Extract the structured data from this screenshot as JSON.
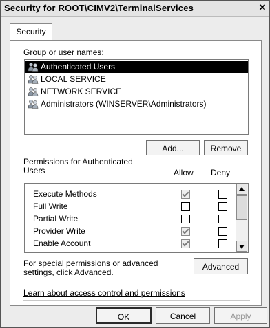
{
  "window": {
    "title": "Security for ROOT\\CIMV2\\TerminalServices",
    "close_glyph": "✕"
  },
  "tabs": [
    {
      "label": "Security"
    }
  ],
  "groups": {
    "label": "Group or user names:",
    "items": [
      {
        "label": "Authenticated Users",
        "selected": true
      },
      {
        "label": "LOCAL SERVICE",
        "selected": false
      },
      {
        "label": "NETWORK SERVICE",
        "selected": false
      },
      {
        "label": "Administrators (WINSERVER\\Administrators)",
        "selected": false
      }
    ],
    "add_label": "Add...",
    "remove_label": "Remove"
  },
  "permissions": {
    "label": "Permissions for Authenticated Users",
    "allow_label": "Allow",
    "deny_label": "Deny",
    "rows": [
      {
        "name": "Execute Methods",
        "allow": "checked-disabled",
        "deny": "unchecked"
      },
      {
        "name": "Full Write",
        "allow": "unchecked",
        "deny": "unchecked"
      },
      {
        "name": "Partial Write",
        "allow": "unchecked",
        "deny": "unchecked"
      },
      {
        "name": "Provider Write",
        "allow": "checked-disabled",
        "deny": "unchecked"
      },
      {
        "name": "Enable Account",
        "allow": "checked-disabled",
        "deny": "unchecked"
      }
    ]
  },
  "advanced": {
    "text": "For special permissions or advanced settings, click Advanced.",
    "button_label": "Advanced"
  },
  "link": {
    "label": "Learn about access control and permissions"
  },
  "footer": {
    "ok_label": "OK",
    "cancel_label": "Cancel",
    "apply_label": "Apply"
  }
}
